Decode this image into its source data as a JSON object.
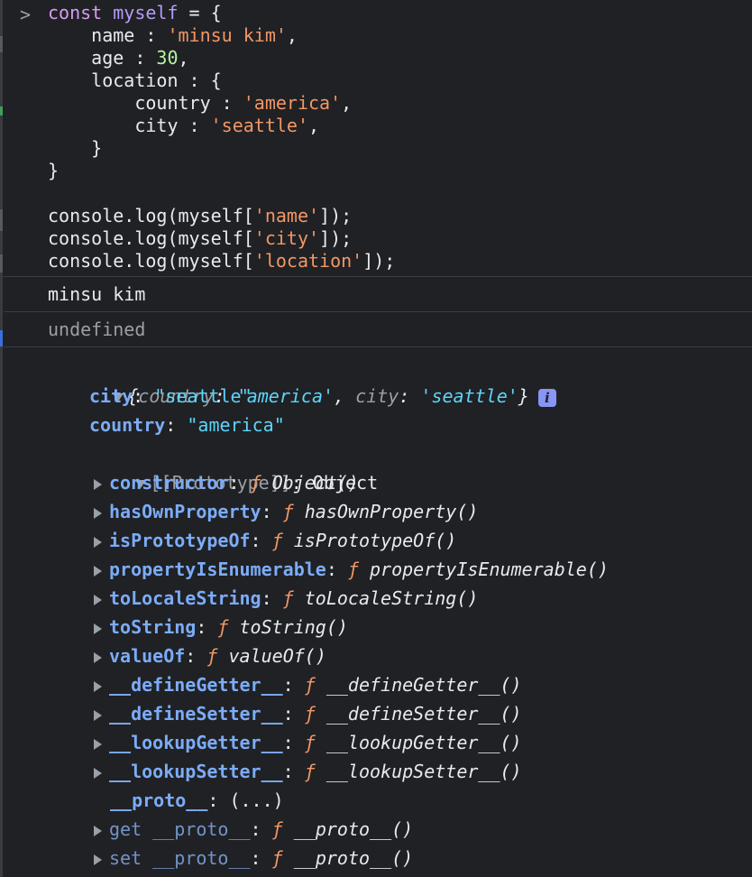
{
  "prompt": {
    "icon": "chevron-right-icon",
    "lines": [
      [
        {
          "t": "const",
          "c": "kw"
        },
        {
          "t": " myself",
          "c": "var"
        },
        {
          "t": " = {",
          "c": "ident"
        }
      ],
      [
        {
          "t": "    name : ",
          "c": "ident"
        },
        {
          "t": "'minsu kim'",
          "c": "str"
        },
        {
          "t": ",",
          "c": "ident"
        }
      ],
      [
        {
          "t": "    age : ",
          "c": "ident"
        },
        {
          "t": "30",
          "c": "num"
        },
        {
          "t": ",",
          "c": "ident"
        }
      ],
      [
        {
          "t": "    location : {",
          "c": "ident"
        }
      ],
      [
        {
          "t": "        country : ",
          "c": "ident"
        },
        {
          "t": "'america'",
          "c": "str"
        },
        {
          "t": ",",
          "c": "ident"
        }
      ],
      [
        {
          "t": "        city : ",
          "c": "ident"
        },
        {
          "t": "'seattle'",
          "c": "str"
        },
        {
          "t": ",",
          "c": "ident"
        }
      ],
      [
        {
          "t": "    }",
          "c": "ident"
        }
      ],
      [
        {
          "t": "}",
          "c": "ident"
        }
      ],
      [
        {
          "t": "",
          "c": "ident"
        }
      ],
      [
        {
          "t": "console.log(myself[",
          "c": "ident"
        },
        {
          "t": "'name'",
          "c": "str"
        },
        {
          "t": "]);",
          "c": "ident"
        }
      ],
      [
        {
          "t": "console.log(myself[",
          "c": "ident"
        },
        {
          "t": "'city'",
          "c": "str"
        },
        {
          "t": "]);",
          "c": "ident"
        }
      ],
      [
        {
          "t": "console.log(myself[",
          "c": "ident"
        },
        {
          "t": "'location'",
          "c": "str"
        },
        {
          "t": "]);",
          "c": "ident"
        }
      ]
    ]
  },
  "output": {
    "name_log": "minsu kim",
    "city_log": "undefined",
    "object": {
      "preview_open": "{",
      "preview_key1": "country",
      "preview_sep": ": ",
      "preview_val1": "'america'",
      "preview_comma": ", ",
      "preview_key2": "city",
      "preview_val2": "'seattle'",
      "preview_close": "}",
      "info_badge": "i",
      "properties": [
        {
          "key": "city",
          "value": "\"seattle\""
        },
        {
          "key": "country",
          "value": "\"america\""
        }
      ],
      "prototype": {
        "label": "[[Prototype]]",
        "value": "Object",
        "members": [
          {
            "key": "constructor",
            "fn": "Object()",
            "expandable": true,
            "dim": false
          },
          {
            "key": "hasOwnProperty",
            "fn": "hasOwnProperty()",
            "expandable": true,
            "dim": false
          },
          {
            "key": "isPrototypeOf",
            "fn": "isPrototypeOf()",
            "expandable": true,
            "dim": false
          },
          {
            "key": "propertyIsEnumerable",
            "fn": "propertyIsEnumerable()",
            "expandable": true,
            "dim": false
          },
          {
            "key": "toLocaleString",
            "fn": "toLocaleString()",
            "expandable": true,
            "dim": false
          },
          {
            "key": "toString",
            "fn": "toString()",
            "expandable": true,
            "dim": false
          },
          {
            "key": "valueOf",
            "fn": "valueOf()",
            "expandable": true,
            "dim": false
          },
          {
            "key": "__defineGetter__",
            "fn": "__defineGetter__()",
            "expandable": true,
            "dim": false
          },
          {
            "key": "__defineSetter__",
            "fn": "__defineSetter__()",
            "expandable": true,
            "dim": false
          },
          {
            "key": "__lookupGetter__",
            "fn": "__lookupGetter__()",
            "expandable": true,
            "dim": false
          },
          {
            "key": "__lookupSetter__",
            "fn": "__lookupSetter__()",
            "expandable": true,
            "dim": false
          },
          {
            "key": "__proto__",
            "plain": "(...)",
            "expandable": false,
            "dim": false
          },
          {
            "key": "get __proto__",
            "fn": "__proto__()",
            "expandable": true,
            "dim": true
          },
          {
            "key": "set __proto__",
            "fn": "__proto__()",
            "expandable": true,
            "dim": true
          }
        ]
      }
    }
  },
  "f_glyph": "ƒ",
  "colors": {
    "background": "#202124",
    "string": "#f29766",
    "number": "#b5f2a6",
    "keyword": "#d69cf2",
    "key": "#7cacf8",
    "value_string": "#5cd5fb"
  }
}
